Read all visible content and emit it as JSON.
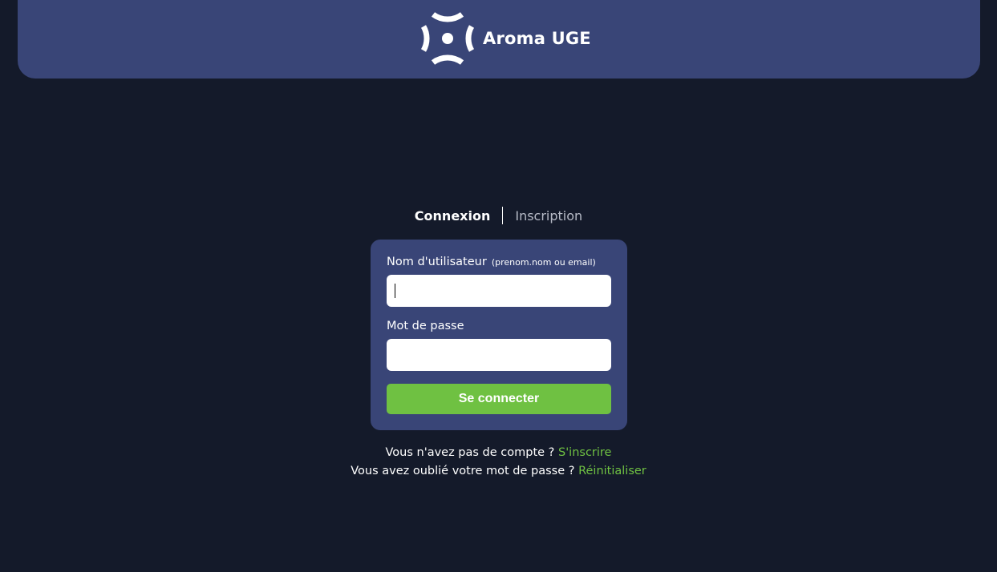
{
  "brand": {
    "name": "Aroma UGE",
    "logo_icon": "aroma-uge-logo-icon"
  },
  "tabs": [
    {
      "label": "Connexion",
      "active": true
    },
    {
      "label": "Inscription",
      "active": false
    }
  ],
  "login_form": {
    "username": {
      "label": "Nom d'utilisateur",
      "hint": "(prenom.nom ou email)",
      "value": ""
    },
    "password": {
      "label": "Mot de passe",
      "value": ""
    },
    "submit_label": "Se connecter"
  },
  "footer": {
    "signup_prompt": "Vous n'avez pas de compte ?",
    "signup_link": "S'inscrire",
    "reset_prompt": "Vous avez oublié votre mot de passe ?",
    "reset_link": "Réinitialiser"
  },
  "colors": {
    "page_background": "#141a2a",
    "header_background": "#394577",
    "card_background": "#394577",
    "accent_green": "#6fc142",
    "inactive_tab": "#b6bac6"
  }
}
